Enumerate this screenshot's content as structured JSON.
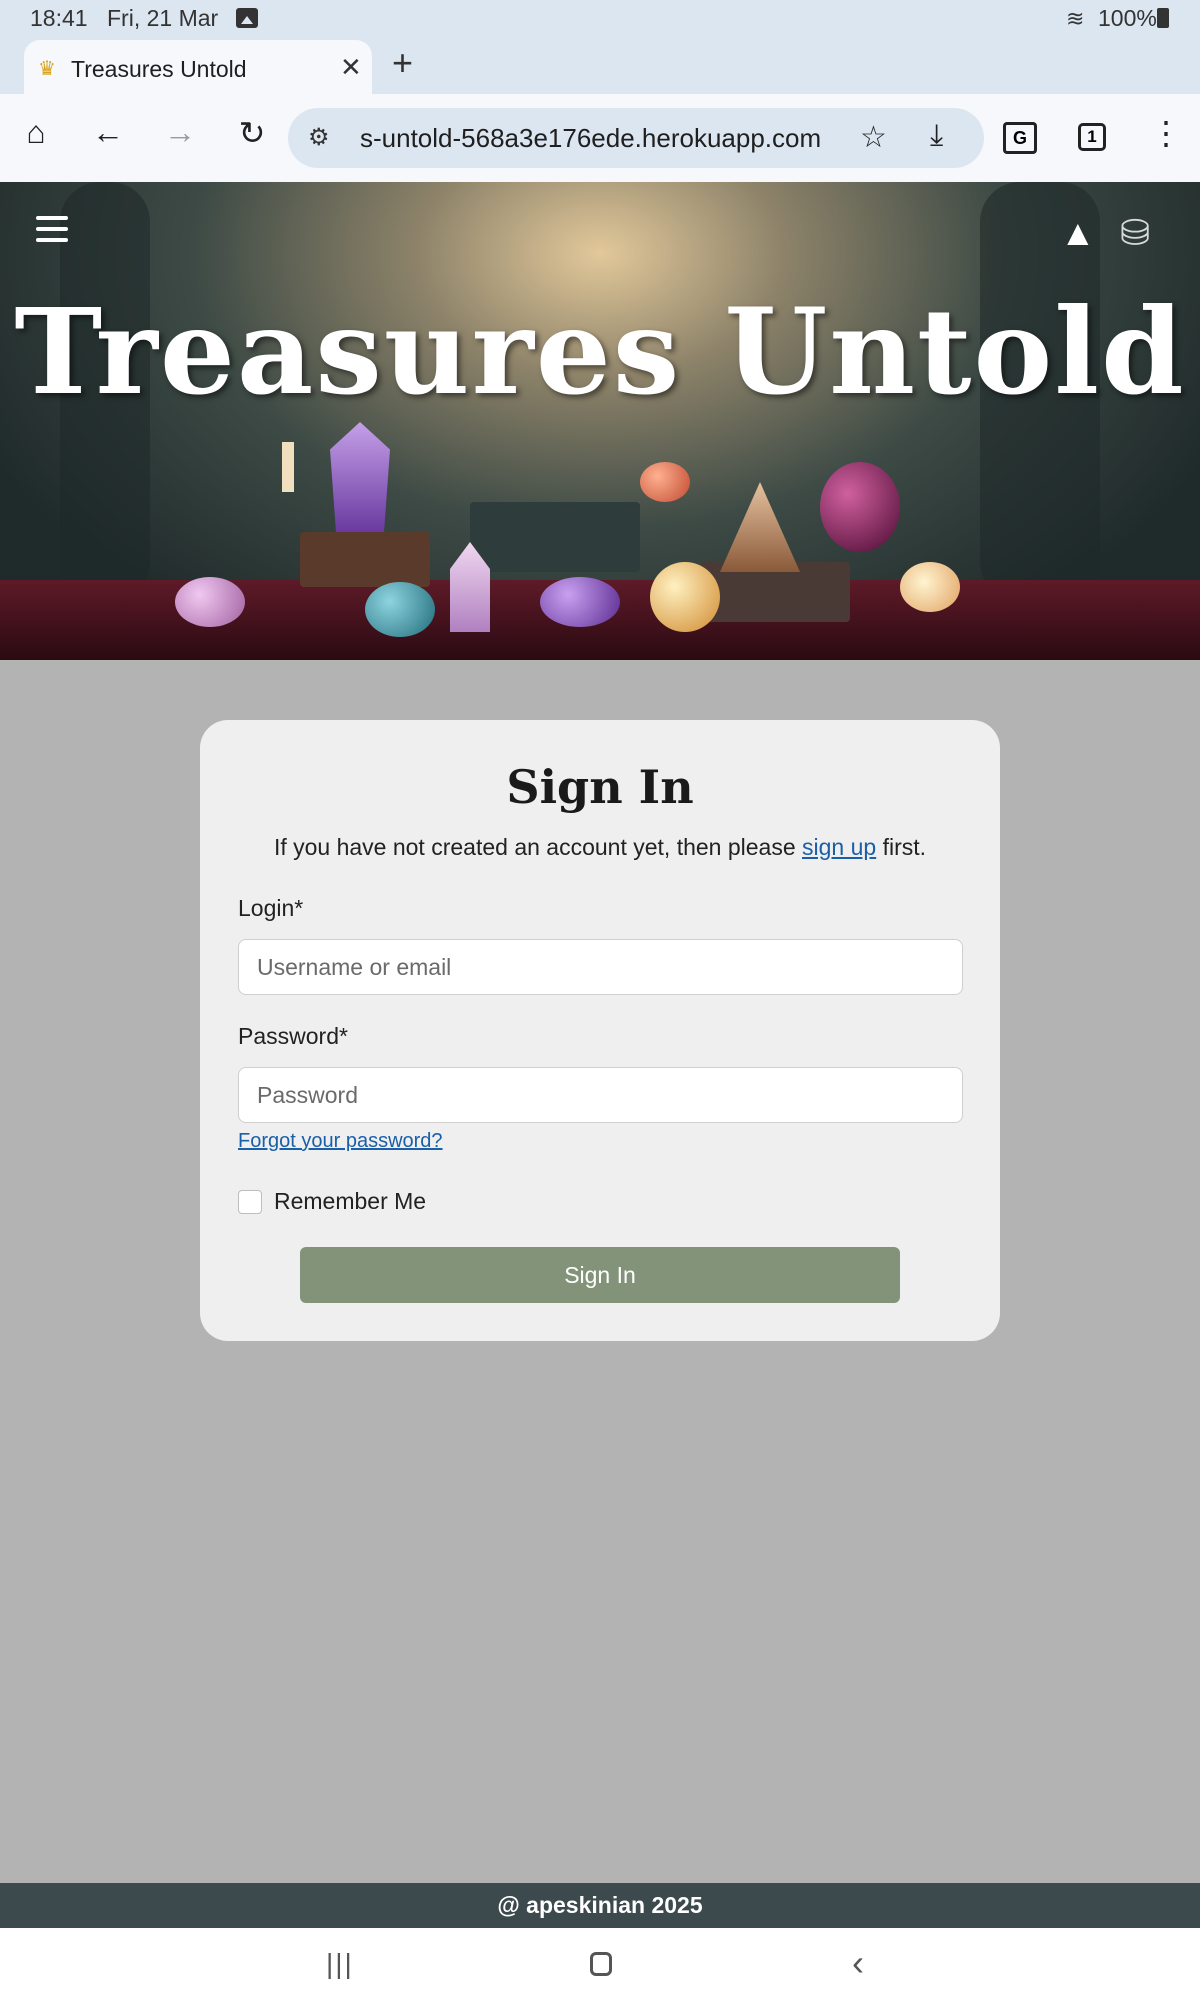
{
  "status_bar": {
    "time": "18:41",
    "date": "Fri, 21 Mar",
    "battery": "100%"
  },
  "browser": {
    "tab_title": "Treasures Untold",
    "url": "s-untold-568a3e176ede.herokuapp.com",
    "tab_count": "1",
    "new_tab_symbol": "+",
    "close_symbol": "✕"
  },
  "header": {
    "site_title": "Treasures Untold"
  },
  "signin": {
    "heading": "Sign In",
    "intro_before": "If you have not created an account yet, then please ",
    "signup_link": "sign up",
    "intro_after": " first.",
    "login_label": "Login*",
    "login_placeholder": "Username or email",
    "password_label": "Password*",
    "password_placeholder": "Password",
    "forgot_link": "Forgot your password?",
    "remember_label": "Remember Me",
    "submit_label": "Sign In"
  },
  "footer": {
    "text": "@ apeskinian 2025"
  },
  "colors": {
    "page_bg": "#b3b3b3",
    "card_bg": "#efefef",
    "button": "#839379",
    "footer": "#3c4a4d",
    "link": "#1a5fa8"
  },
  "icons": [
    "home-icon",
    "back-icon",
    "forward-icon",
    "reload-icon",
    "site-settings-icon",
    "bookmark-star-icon",
    "download-icon",
    "translate-icon",
    "tab-switcher-icon",
    "more-menu-icon",
    "hamburger-menu-icon",
    "wizard-hat-icon",
    "basket-icon"
  ]
}
